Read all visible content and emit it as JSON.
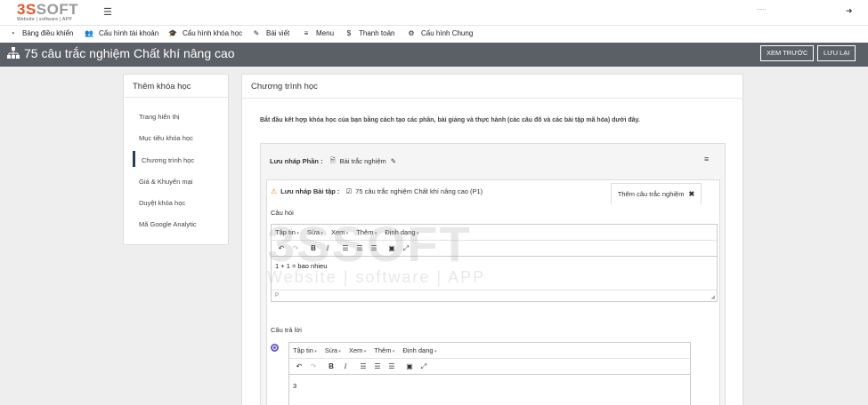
{
  "header": {
    "logo_main_a": "3S",
    "logo_main_b": "SOFT",
    "logo_sub": "Website | software | APP",
    "user_text": "......"
  },
  "nav": [
    {
      "label": "Bảng điều khiển",
      "icon": "dashboard-icon"
    },
    {
      "label": "Cấu hình tài khoản",
      "icon": "users-icon"
    },
    {
      "label": "Cấu hình khóa học",
      "icon": "graduation-cap-icon"
    },
    {
      "label": "Bài viết",
      "icon": "edit-icon"
    },
    {
      "label": "Menu",
      "icon": "list-icon"
    },
    {
      "label": "Thanh toán",
      "icon": "dollar-icon"
    },
    {
      "label": "Cấu hình Chung",
      "icon": "gear-icon"
    }
  ],
  "titlebar": {
    "title": "75 câu trắc nghiệm Chất khí nâng cao",
    "preview_label": "XEM TRƯỚC",
    "save_label": "LƯU LẠI"
  },
  "sidebar": {
    "title": "Thêm khóa học",
    "items": [
      {
        "label": "Trang hiển thị"
      },
      {
        "label": "Mục tiêu khóa học"
      },
      {
        "label": "Chương trình học",
        "active": true
      },
      {
        "label": "Giá & Khuyến mại"
      },
      {
        "label": "Duyệt khóa học"
      },
      {
        "label": "Mã Google Analytic"
      }
    ]
  },
  "main": {
    "title": "Chương trình học",
    "intro": "Bắt đầu kết hợp khóa học của bạn bằng cách tạo các phần, bài giảng và thực hành (các câu đố và các bài tập mã hóa) dưới đây.",
    "section": {
      "label": "Lưu nháp Phần :",
      "name": "Bài trắc nghiệm"
    },
    "lecture": {
      "label": "Lưu nháp Bài tập :",
      "name": "75 câu trắc nghiệm Chất khí nâng cao (P1)",
      "add_tab_label": "Thêm câu trắc nghiệm"
    },
    "question_label": "Câu hỏi",
    "answer_label": "Câu trả lời"
  },
  "editor": {
    "menus": [
      "Tập tin",
      "Sửa",
      "Xem",
      "Thêm",
      "Định dạng"
    ],
    "question_content": "1 + 1 = bao nhieu",
    "status_path": "P",
    "answer_content": "3"
  },
  "watermark": {
    "main": "3SSOFT",
    "sub": "Website | software | APP"
  },
  "colors": {
    "accent": "#e8542a",
    "titlebar": "#5b5f66",
    "active_bar": "#2c3e50",
    "radio": "#6a5acd",
    "warning": "#e08e0b"
  }
}
